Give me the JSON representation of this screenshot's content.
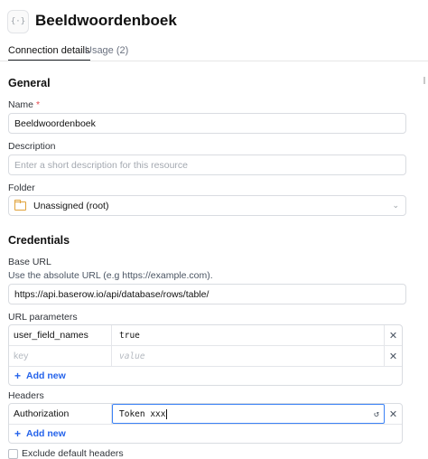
{
  "header": {
    "icon": "braces-icon",
    "icon_glyph": "{·}",
    "title": "Beeldwoordenboek"
  },
  "tabs": [
    {
      "label": "Connection details",
      "active": true
    },
    {
      "label": "Usage (2)",
      "active": false
    }
  ],
  "general": {
    "heading": "General",
    "name_label": "Name",
    "required_mark": "*",
    "name_value": "Beeldwoordenboek",
    "description_label": "Description",
    "description_placeholder": "Enter a short description for this resource",
    "folder_label": "Folder",
    "folder_value": "Unassigned (root)"
  },
  "credentials": {
    "heading": "Credentials",
    "base_url_label": "Base URL",
    "base_url_help": "Use the absolute URL (e.g https://example.com).",
    "base_url_value": "https://api.baserow.io/api/database/rows/table/",
    "url_params_label": "URL parameters",
    "url_params": [
      {
        "key": "user_field_names",
        "value": "true"
      }
    ],
    "key_placeholder": "key",
    "value_placeholder": "value",
    "add_new_label": "Add new",
    "headers_label": "Headers",
    "headers": [
      {
        "key": "Authorization",
        "value": "Token xxx"
      }
    ],
    "exclude_default_headers_label": "Exclude default headers"
  },
  "colors": {
    "accent": "#2563eb",
    "focus": "#3b82f6",
    "required": "#e5484d",
    "folder": "#e0a23a"
  }
}
